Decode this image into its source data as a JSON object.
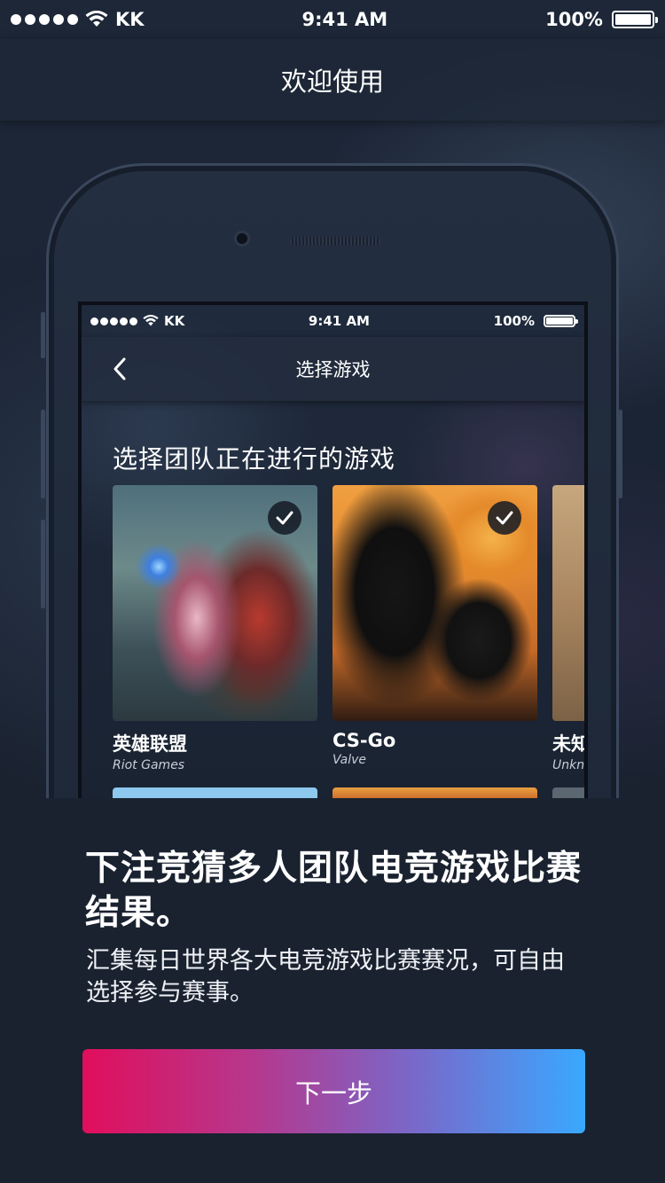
{
  "status_bar": {
    "carrier": "KK",
    "time": "9:41 AM",
    "battery": "100%"
  },
  "nav": {
    "title": "欢迎使用"
  },
  "mockup": {
    "status_bar": {
      "carrier": "KK",
      "time": "9:41 AM",
      "battery": "100%"
    },
    "nav": {
      "title": "选择游戏"
    },
    "section_title": "选择团队正在进行的游戏",
    "games": [
      {
        "name": "英雄联盟",
        "developer": "Riot Games",
        "selected": true
      },
      {
        "name": "CS-Go",
        "developer": "Valve",
        "selected": true
      },
      {
        "name": "未知",
        "developer": "Unknown",
        "selected": false
      }
    ]
  },
  "onboarding": {
    "headline": "下注竞猜多人团队电竞游戏比赛结果。",
    "description": "汇集每日世界各大电竞游戏比赛赛况，可自由选择参与赛事。",
    "next_button": "下一步"
  },
  "colors": {
    "background": "#1a2230",
    "button_gradient_start": "#e10e5c",
    "button_gradient_end": "#39a8ff"
  },
  "icons": [
    "wifi-icon",
    "battery-icon",
    "back-chevron-icon",
    "checkmark-icon"
  ]
}
